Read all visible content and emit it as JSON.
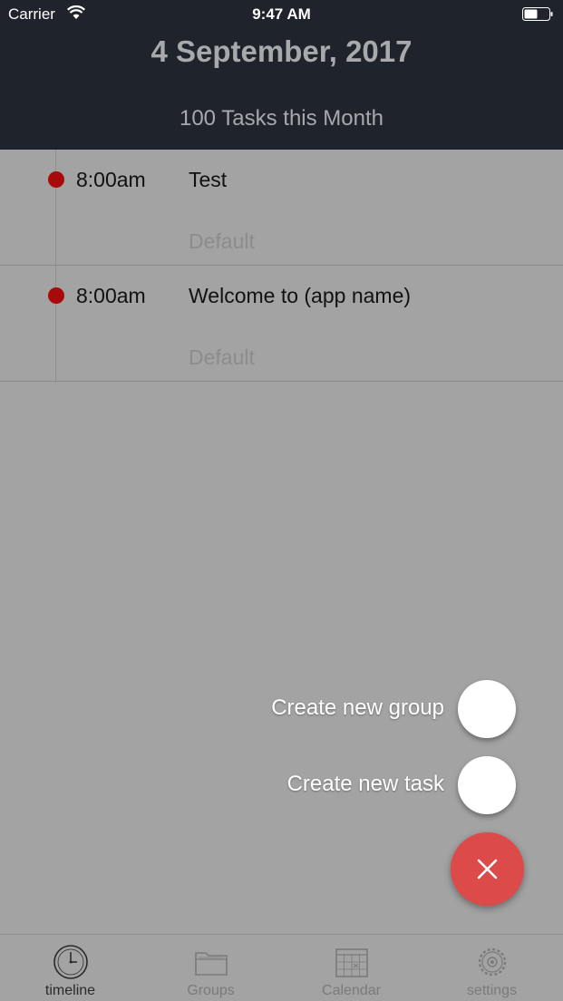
{
  "status_bar": {
    "carrier": "Carrier",
    "time": "9:47 AM"
  },
  "header": {
    "date": "4 September, 2017",
    "summary": "100 Tasks this Month"
  },
  "tasks": [
    {
      "time": "8:00am",
      "title": "Test",
      "group": "Default"
    },
    {
      "time": "8:00am",
      "title": "Welcome to (app name)",
      "group": "Default"
    }
  ],
  "fab_menu": {
    "create_group_label": "Create new group",
    "create_task_label": "Create new task",
    "close_icon": "close-icon"
  },
  "tabs": [
    {
      "label": "timeline",
      "icon": "clock-icon",
      "active": true
    },
    {
      "label": "Groups",
      "icon": "folder-icon",
      "active": false
    },
    {
      "label": "Calendar",
      "icon": "calendar-icon",
      "active": false
    },
    {
      "label": "settings",
      "icon": "gear-icon",
      "active": false
    }
  ],
  "colors": {
    "header_bg": "#1f232b",
    "overlay_bg": "#a3a3a3",
    "task_dot": "#a80a0a",
    "fab_main": "#dc4a4a"
  }
}
